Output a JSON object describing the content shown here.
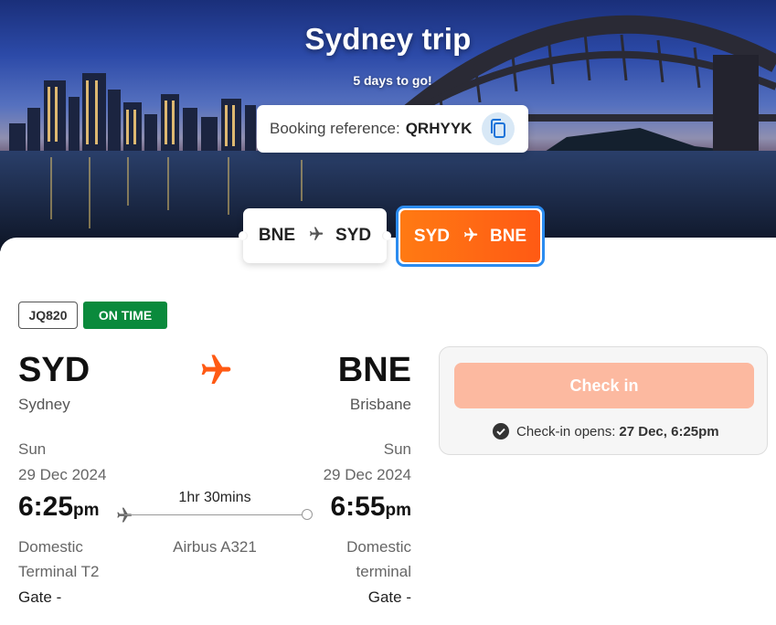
{
  "trip": {
    "title": "Sydney trip",
    "countdown": "5 days to go!",
    "booking_label": "Booking reference:",
    "booking_ref": "QRHYYK",
    "copy_icon": "copy-icon"
  },
  "tabs": [
    {
      "from": "BNE",
      "to": "SYD",
      "selected": false
    },
    {
      "from": "SYD",
      "to": "BNE",
      "selected": true
    }
  ],
  "flight": {
    "number": "JQ820",
    "status": "ON TIME",
    "status_color": "#0a8a3c",
    "origin": {
      "code": "SYD",
      "city": "Sydney",
      "day": "Sun",
      "date": "29 Dec 2024",
      "time": "6:25",
      "ampm": "pm",
      "terminal_line1": "Domestic",
      "terminal_line2": "Terminal T2",
      "gate": "Gate -"
    },
    "destination": {
      "code": "BNE",
      "city": "Brisbane",
      "day": "Sun",
      "date": "29 Dec 2024",
      "time": "6:55",
      "ampm": "pm",
      "terminal_line1": "Domestic",
      "terminal_line2": "terminal",
      "gate": "Gate -"
    },
    "duration": "1hr 30mins",
    "aircraft": "Airbus A321",
    "plane_icon_color": "#ff5a14"
  },
  "checkin": {
    "button_label": "Check in",
    "button_color": "#fcb9a0",
    "opens_label": "Check-in opens:",
    "opens_value": "27 Dec, 6:25pm"
  }
}
